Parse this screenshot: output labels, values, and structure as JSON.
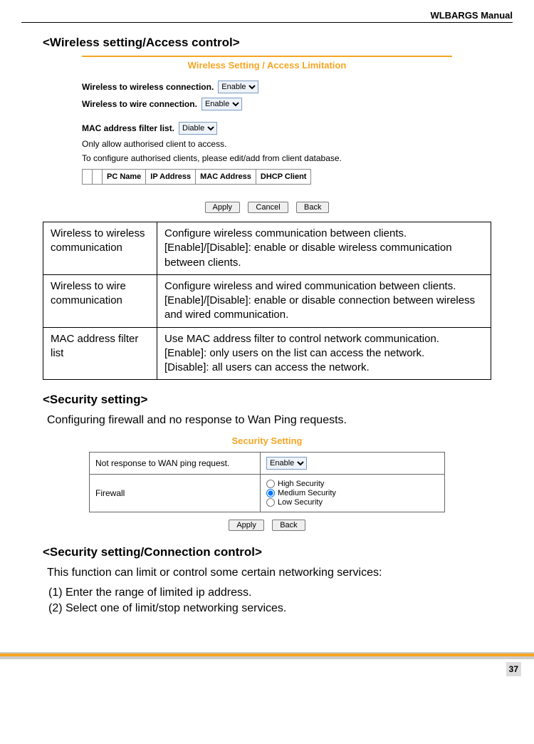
{
  "header": {
    "manual_title": "WLBARGS Manual"
  },
  "sections": {
    "s1": "<Wireless setting/Access control>",
    "s2": "<Security setting>",
    "s3": "<Security setting/Connection control>"
  },
  "shot1": {
    "title": "Wireless Setting / Access Limitation",
    "line_wireless_wireless": "Wireless to wireless connection.",
    "line_wireless_wire": "Wireless to wire connection.",
    "line_mac_filter": "MAC address filter list.",
    "note1": "Only allow authorised client to access.",
    "note2": "To configure authorised clients, please edit/add from client database.",
    "select_enable": "Enable",
    "select_disable": "Diable",
    "table_headers": {
      "h1": "PC Name",
      "h2": "IP Address",
      "h3": "MAC Address",
      "h4": "DHCP Client"
    },
    "buttons": {
      "apply": "Apply",
      "cancel": "Cancel",
      "back": "Back"
    }
  },
  "desc_table": {
    "r1_l": "Wireless to wireless communication",
    "r1_r": "Configure wireless communication between clients. [Enable]/[Disable]: enable or disable wireless communication between clients.",
    "r2_l": "Wireless to wire communication",
    "r2_r": "Configure wireless and wired communication between clients.\n[Enable]/[Disable]: enable or disable connection between wireless and wired communication.",
    "r3_l": "MAC address filter list",
    "r3_r": "Use MAC address filter to control network communication.\n[Enable]: only users on the list can access the network.\n[Disable]: all users can access the network."
  },
  "body": {
    "security_intro": "Configuring firewall and no response to Wan Ping requests.",
    "connctrl_intro": "This function can limit or control some certain networking services:",
    "step1": "(1) Enter the range of limited ip address.",
    "step2": "(2) Select one of limit/stop networking services."
  },
  "shot2": {
    "title": "Security Setting",
    "row1_label": "Not response to WAN ping request.",
    "row1_select": "Enable",
    "row2_label": "Firewall",
    "radios": {
      "high": "High Security",
      "med": "Medium Security",
      "low": "Low Security"
    },
    "buttons": {
      "apply": "Apply",
      "back": "Back"
    }
  },
  "page_number": "37"
}
